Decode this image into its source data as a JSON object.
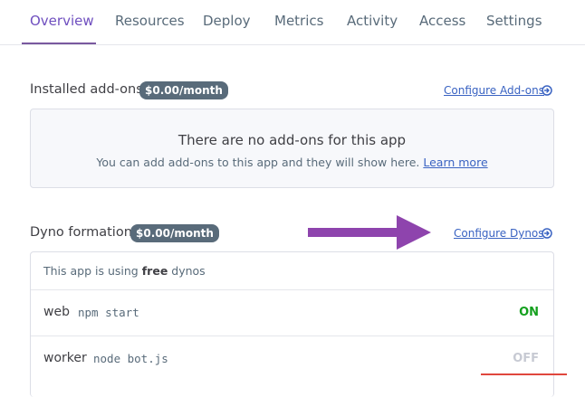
{
  "tabs": [
    {
      "label": "Overview",
      "active": true
    },
    {
      "label": "Resources",
      "active": false
    },
    {
      "label": "Deploy",
      "active": false
    },
    {
      "label": "Metrics",
      "active": false
    },
    {
      "label": "Activity",
      "active": false
    },
    {
      "label": "Access",
      "active": false
    },
    {
      "label": "Settings",
      "active": false
    }
  ],
  "addons": {
    "title": "Installed add-ons",
    "price": "$0.00/month",
    "configure_label": "Configure Add-ons",
    "configure_icon": "arrow-circle-right-icon",
    "empty_title": "There are no add-ons for this app",
    "empty_text": "You can add add-ons to this app and they will show here.",
    "learn_more": "Learn more"
  },
  "dynos": {
    "title": "Dyno formation",
    "price": "$0.00/month",
    "configure_label": "Configure Dynos",
    "configure_icon": "arrow-circle-right-icon",
    "note_prefix": "This app is using",
    "note_tier": "free",
    "note_suffix": "dynos",
    "rows": [
      {
        "name": "web",
        "command": "npm start",
        "status": "ON",
        "status_color": "#14a01e"
      },
      {
        "name": "worker",
        "command": "node bot.js",
        "status": "OFF",
        "status_color": "#c7cad3"
      }
    ]
  },
  "annotations": {
    "arrow_color": "#8e44ad",
    "underline_color": "#e0473d"
  }
}
